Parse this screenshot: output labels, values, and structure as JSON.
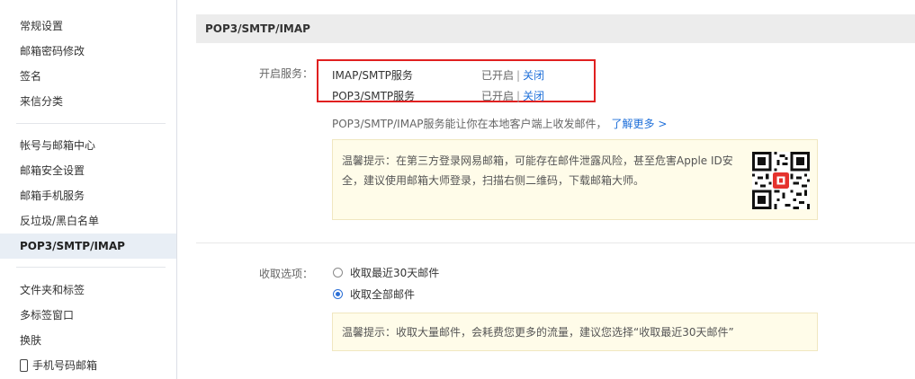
{
  "sidebar": {
    "group1": [
      "常规设置",
      "邮箱密码修改",
      "签名",
      "来信分类"
    ],
    "group2": [
      "帐号与邮箱中心",
      "邮箱安全设置",
      "邮箱手机服务",
      "反垃圾/黑白名单",
      "POP3/SMTP/IMAP"
    ],
    "group3": [
      "文件夹和标签",
      "多标签窗口",
      "换肤",
      "手机号码邮箱"
    ],
    "active": "POP3/SMTP/IMAP"
  },
  "main": {
    "title": "POP3/SMTP/IMAP",
    "services_label": "开启服务：",
    "services": [
      {
        "name": "IMAP/SMTP服务",
        "status": "已开启",
        "sep": "|",
        "action": "关闭"
      },
      {
        "name": "POP3/SMTP服务",
        "status": "已开启",
        "sep": "|",
        "action": "关闭"
      }
    ],
    "description": "POP3/SMTP/IMAP服务能让你在本地客户端上收发邮件，",
    "learn_more": "了解更多 >",
    "tip1_line1": "温馨提示：在第三方登录网易邮箱，可能存在邮件泄露风险，甚至危害Apple ID安",
    "tip1_line2": "全，建议使用邮箱大师登录，扫描右侧二维码，下载邮箱大师。",
    "receive_label": "收取选项：",
    "receive_options": [
      {
        "label": "收取最近30天邮件",
        "checked": false
      },
      {
        "label": "收取全部邮件",
        "checked": true
      }
    ],
    "tip2": "温馨提示：收取大量邮件，会耗费您更多的流量，建议您选择“收取最近30天邮件”"
  },
  "colors": {
    "link": "#1e6fd9",
    "highlight_border": "#e02020",
    "tip_bg": "#fffce9",
    "active_bg": "#e8eef5",
    "title_bg": "#ececec"
  },
  "icons": {
    "phone": "phone-icon",
    "qr": "qr-code-icon"
  }
}
